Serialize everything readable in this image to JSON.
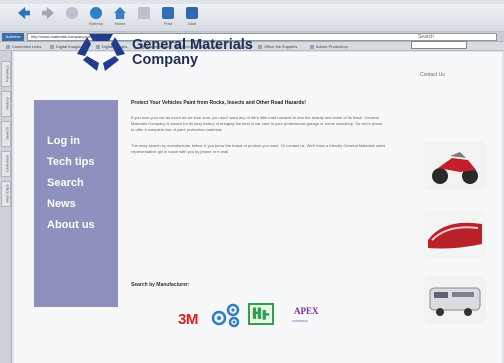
{
  "toolbar": {
    "buttons": [
      {
        "label": "",
        "icon": "back-arrow-icon"
      },
      {
        "label": "",
        "icon": "forward-arrow-icon"
      },
      {
        "label": "",
        "icon": "stop-icon"
      },
      {
        "label": "Refresh",
        "icon": "refresh-icon"
      },
      {
        "label": "Home",
        "icon": "home-icon"
      },
      {
        "label": "",
        "icon": "history-icon"
      },
      {
        "label": "Print",
        "icon": "print-icon"
      },
      {
        "label": "Mail",
        "icon": "mail-icon"
      }
    ]
  },
  "addressbar": {
    "label": "Address",
    "url": "http://www.materials-company.com/autobody"
  },
  "linksbar": {
    "items": [
      "Customize Links",
      "Digital Imaging",
      "Digital Images",
      "Adobe Home",
      "Microsoft Home Page",
      "AOL",
      "Office Ink Supplies",
      "Adobe Photoshop"
    ]
  },
  "sidetabs": [
    "Favorites",
    "History",
    "Search",
    "Channels",
    "Web Clips"
  ],
  "site": {
    "company_line1": "General Materials",
    "company_line2": "Company",
    "search_label": "Search",
    "search_value": "",
    "contact_label": "Contact Us",
    "nav": [
      "Log in",
      "Tech tips",
      "Search",
      "News",
      "About us"
    ],
    "headline": "Protect Your Vehicles Paint from Rocks, Insects and Other Road Hazards!",
    "para1": "If you love your car as much as we love ours, you don't want any of life's little road hazards to mar the beauty and shine of its finish. General Materials Company is known for its long history of bringing the best in car care to your professional garage or home workshop. So we're proud to offer a complete line of paint protection materials.",
    "para2": "The easy search by manufacturer below. If you know the brand of product you want. Or contact us. We'll have a friendly General Materials sales representative get in touch with you by phone or e-mail.",
    "by_manufacturer": "Search by Manufacturer:",
    "manufacturers": {
      "m3": "3M",
      "apex": "APEX",
      "apex_sub": "COATINGS"
    }
  },
  "colors": {
    "nav_bg": "#8e90be",
    "company_text": "#1f2e55",
    "logo_blue": "#243a8c",
    "brand_3m": "#e01b1b",
    "brand_apex": "#7b2aa6",
    "brand_green": "#2ea24a"
  }
}
